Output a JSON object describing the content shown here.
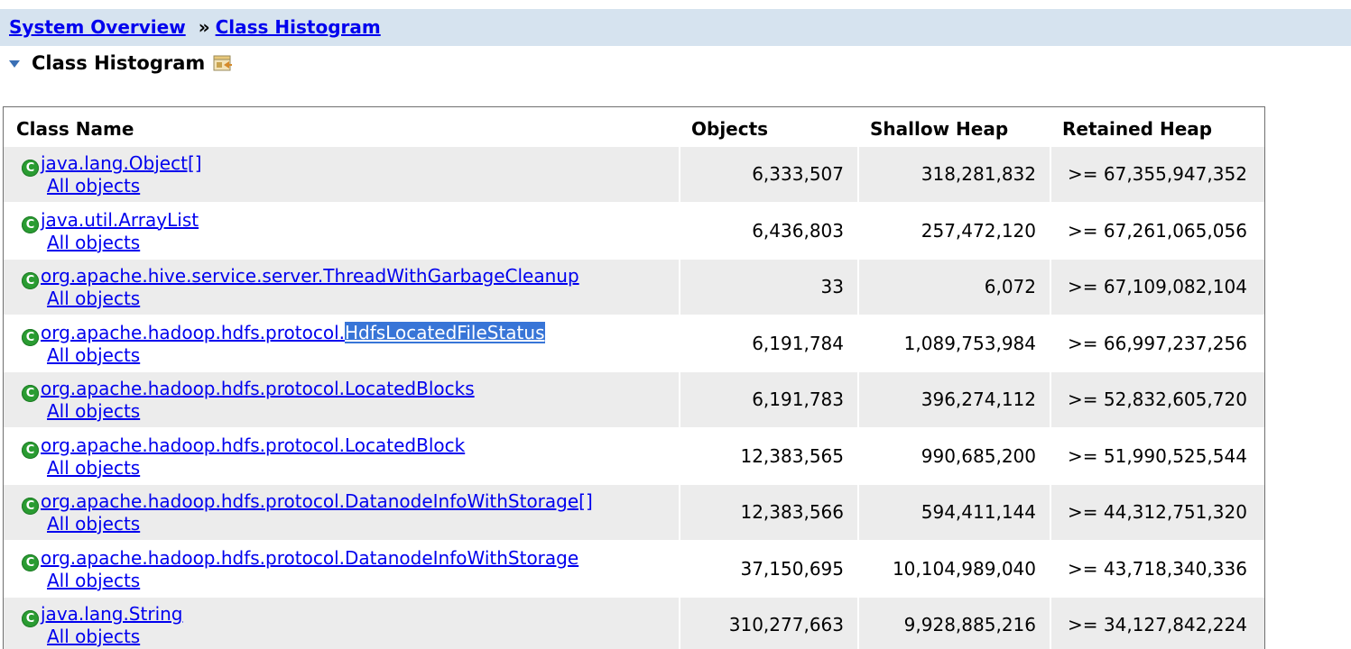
{
  "breadcrumb": {
    "root": "System Overview",
    "separator": "»",
    "current": "Class Histogram"
  },
  "section": {
    "title": "Class Histogram",
    "toggle_icon": "collapse-triangle-icon",
    "export_icon": "export-icon"
  },
  "table": {
    "headers": [
      "Class Name",
      "Objects",
      "Shallow Heap",
      "Retained Heap"
    ],
    "all_objects_label": "All objects",
    "rows": [
      {
        "class_prefix": "java.lang.Object[]",
        "class_highlight": "",
        "objects": "6,333,507",
        "shallow": "318,281,832",
        "retained": ">= 67,355,947,352"
      },
      {
        "class_prefix": "java.util.ArrayList",
        "class_highlight": "",
        "objects": "6,436,803",
        "shallow": "257,472,120",
        "retained": ">= 67,261,065,056"
      },
      {
        "class_prefix": "org.apache.hive.service.server.ThreadWithGarbageCleanup",
        "class_highlight": "",
        "objects": "33",
        "shallow": "6,072",
        "retained": ">= 67,109,082,104"
      },
      {
        "class_prefix": "org.apache.hadoop.hdfs.protocol.",
        "class_highlight": "HdfsLocatedFileStatus",
        "objects": "6,191,784",
        "shallow": "1,089,753,984",
        "retained": ">= 66,997,237,256"
      },
      {
        "class_prefix": "org.apache.hadoop.hdfs.protocol.LocatedBlocks",
        "class_highlight": "",
        "objects": "6,191,783",
        "shallow": "396,274,112",
        "retained": ">= 52,832,605,720"
      },
      {
        "class_prefix": "org.apache.hadoop.hdfs.protocol.LocatedBlock",
        "class_highlight": "",
        "objects": "12,383,565",
        "shallow": "990,685,200",
        "retained": ">= 51,990,525,544"
      },
      {
        "class_prefix": "org.apache.hadoop.hdfs.protocol.DatanodeInfoWithStorage[]",
        "class_highlight": "",
        "objects": "12,383,566",
        "shallow": "594,411,144",
        "retained": ">= 44,312,751,320"
      },
      {
        "class_prefix": "org.apache.hadoop.hdfs.protocol.DatanodeInfoWithStorage",
        "class_highlight": "",
        "objects": "37,150,695",
        "shallow": "10,104,989,040",
        "retained": ">= 43,718,340,336"
      },
      {
        "class_prefix": "java.lang.String",
        "class_highlight": "",
        "objects": "310,277,663",
        "shallow": "9,928,885,216",
        "retained": ">= 34,127,842,224"
      }
    ]
  },
  "colors": {
    "breadcrumb_bg": "#d6e3ef",
    "link": "#0000ee",
    "row_alt": "#ececec",
    "class_icon": "#2a9c32",
    "selection": "#3875d7"
  }
}
